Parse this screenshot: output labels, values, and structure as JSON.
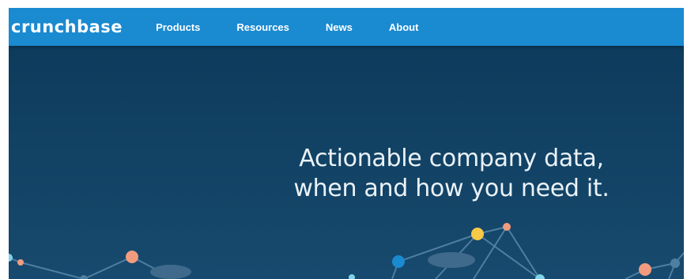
{
  "brand": {
    "logo_text": "crunchbase"
  },
  "nav": {
    "items": [
      {
        "label": "Products"
      },
      {
        "label": "Resources"
      },
      {
        "label": "News"
      },
      {
        "label": "About"
      }
    ]
  },
  "hero": {
    "headline_line1": "Actionable company data,",
    "headline_line2": "when and how you need it."
  },
  "colors": {
    "nav_background": "#1a8ad1",
    "hero_background": "#0d3b5c",
    "node_orange": "#f39b7f",
    "node_yellow": "#f7c948",
    "node_blue": "#1a8ad1",
    "node_cyan": "#7fd3e6",
    "line": "#4e7ea0"
  }
}
